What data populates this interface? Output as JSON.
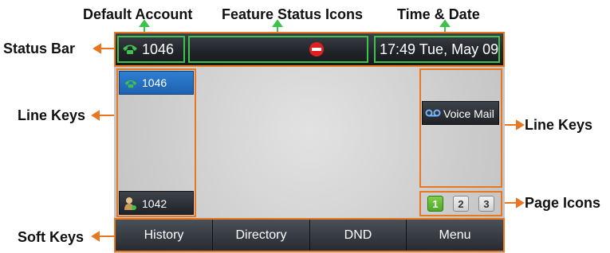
{
  "callouts": {
    "default_account": "Default Account",
    "feature_status_icons": "Feature Status Icons",
    "time_date": "Time & Date",
    "status_bar": "Status Bar",
    "line_keys_left": "Line Keys",
    "line_keys_right": "Line Keys",
    "page_icons": "Page Icons",
    "soft_keys": "Soft Keys"
  },
  "status_bar": {
    "account": "1046",
    "time_date": "17:49 Tue, May 09"
  },
  "line_keys": {
    "left": [
      {
        "label": "1046",
        "icon": "phone-icon"
      },
      {
        "label": "1042",
        "icon": "contact-icon"
      }
    ],
    "right": [
      {
        "label": "Voice Mail",
        "icon": "voicemail-icon"
      }
    ]
  },
  "page_icons": [
    "1",
    "2",
    "3"
  ],
  "soft_keys": [
    "History",
    "Directory",
    "DND",
    "Menu"
  ],
  "colors": {
    "callout_border": "#e87722",
    "status_highlight": "#3cc44a",
    "selected_linekey": "#1e63b0",
    "active_page": "#5dbb2d"
  }
}
